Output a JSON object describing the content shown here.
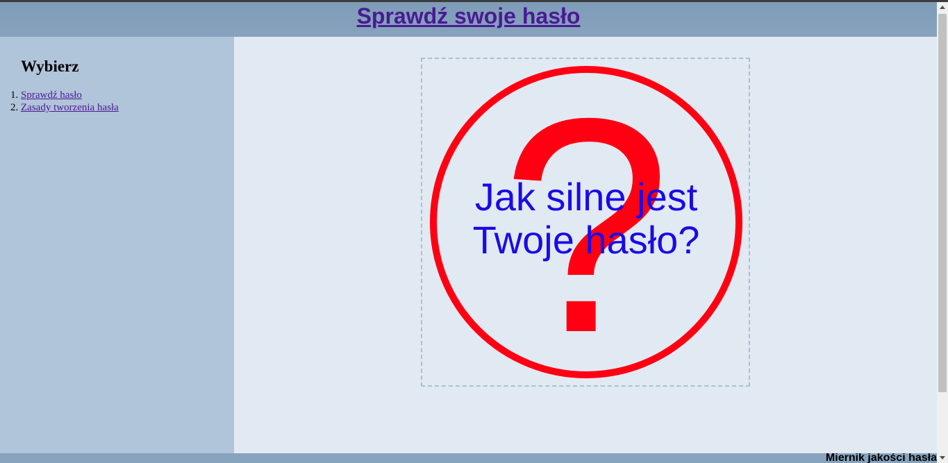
{
  "header": {
    "title": "Sprawdź swoje hasło"
  },
  "sidebar": {
    "heading": "Wybierz",
    "items": [
      {
        "label": "Sprawdź hasło"
      },
      {
        "label": "Zasady tworzenia hasła"
      }
    ]
  },
  "main": {
    "graphic": {
      "question_mark": "?",
      "text_line1": "Jak silne jest",
      "text_line2": "Twoje hasło?"
    }
  },
  "footer": {
    "label": "Miernik jakości hasła"
  },
  "colors": {
    "header_bg": "#87a3be",
    "sidebar_bg": "#b0c4da",
    "main_bg": "#e1e9f2",
    "link": "#4a1a94",
    "graphic_red": "#ff0013",
    "graphic_text": "#1a0ae6"
  }
}
